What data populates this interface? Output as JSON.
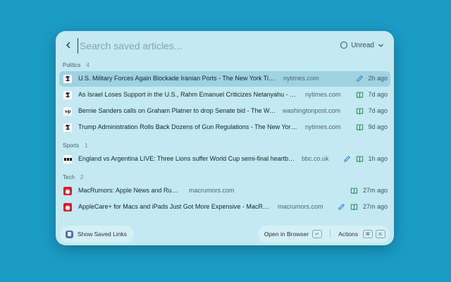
{
  "search": {
    "placeholder": "Search saved articles...",
    "value": ""
  },
  "filter": {
    "label": "Unread"
  },
  "sections": [
    {
      "name": "Politics",
      "count": "4",
      "items": [
        {
          "favicon": "nyt",
          "title": "U.S. Military Forces Again Blockade Iranian Ports - The New York Times",
          "domain": "nytimes.com",
          "time": "2h ago",
          "selected": true,
          "icons": [
            "pencil"
          ]
        },
        {
          "favicon": "nyt",
          "title": "As Israel Loses Support in the U.S., Rahm Emanuel Criticizes Netanyahu - The New York Times",
          "domain": "nytimes.com",
          "time": "7d ago",
          "icons": [
            "book"
          ]
        },
        {
          "favicon": "wp",
          "title": "Bernie Sanders calls on Graham Platner to drop Senate bid - The Washington Post",
          "domain": "washingtonpost.com",
          "time": "7d ago",
          "icons": [
            "book"
          ]
        },
        {
          "favicon": "nyt",
          "title": "Trump Administration Rolls Back Dozens of Gun Regulations - The New York Times",
          "domain": "nytimes.com",
          "time": "9d ago",
          "icons": [
            "book"
          ]
        }
      ]
    },
    {
      "name": "Sports",
      "count": "1",
      "items": [
        {
          "favicon": "bbc",
          "title": "England vs Argentina LIVE: Three Lions suffer World Cup semi-final heartbreak",
          "domain": "bbc.co.uk",
          "time": "1h ago",
          "icons": [
            "pencil",
            "book"
          ]
        }
      ]
    },
    {
      "name": "Tech",
      "count": "2",
      "items": [
        {
          "favicon": "mr",
          "title": "MacRumors: Apple News and Rumors",
          "domain": "macrumors.com",
          "time": "27m ago",
          "icons": [
            "book"
          ]
        },
        {
          "favicon": "mr",
          "title": "AppleCare+ for Macs and iPads Just Got More Expensive - MacRumors",
          "domain": "macrumors.com",
          "time": "27m ago",
          "icons": [
            "pencil",
            "book"
          ]
        }
      ]
    }
  ],
  "footer": {
    "show_saved_links": "Show Saved Links",
    "open_in_browser": "Open in Browser",
    "open_key": "↵",
    "actions": "Actions",
    "actions_keys": [
      "⌘",
      "K"
    ]
  },
  "colors": {
    "background": "#1b9cc7",
    "panel": "#c3e9f2",
    "selected_row": "#9fd3e1",
    "edit_blue": "#2f7fd0",
    "book_green": "#2e8a62"
  }
}
